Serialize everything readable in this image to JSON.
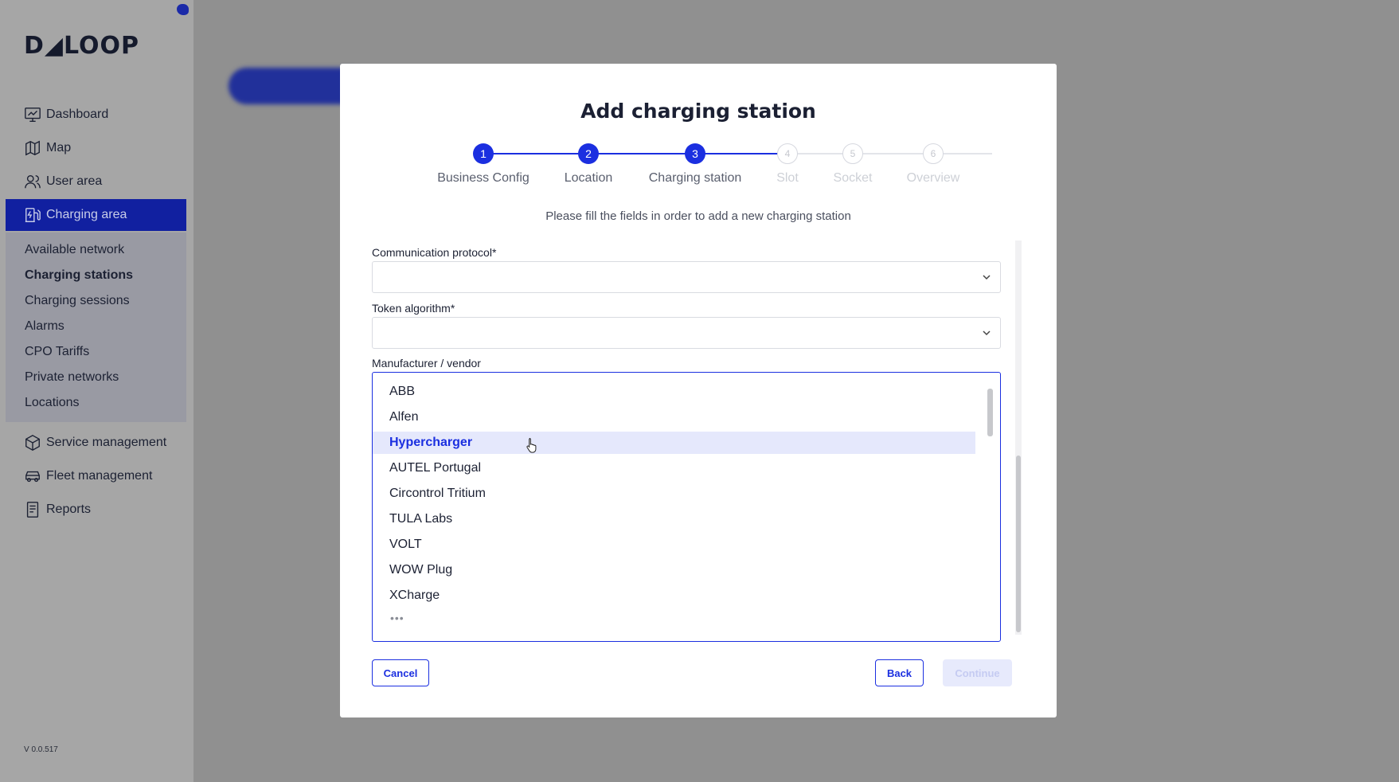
{
  "sidebar": {
    "logo": "D◢LOOP",
    "version": "V 0.0.517",
    "items": [
      {
        "label": "Dashboard",
        "icon": "dashboard-icon"
      },
      {
        "label": "Map",
        "icon": "map-icon"
      },
      {
        "label": "User area",
        "icon": "users-icon"
      },
      {
        "label": "Charging area",
        "icon": "charging-station-icon",
        "active": true
      },
      {
        "label": "Service management",
        "icon": "box-icon"
      },
      {
        "label": "Fleet management",
        "icon": "car-icon"
      },
      {
        "label": "Reports",
        "icon": "report-icon"
      }
    ],
    "submenu": [
      {
        "label": "Available network"
      },
      {
        "label": "Charging stations",
        "current": true
      },
      {
        "label": "Charging sessions"
      },
      {
        "label": "Alarms"
      },
      {
        "label": "CPO Tariffs"
      },
      {
        "label": "Private networks"
      },
      {
        "label": "Locations"
      }
    ]
  },
  "modal": {
    "title": "Add charging station",
    "subtitle": "Please fill the fields in order to add a new charging station",
    "steps": [
      {
        "number": "1",
        "label": "Business Config",
        "state": "done"
      },
      {
        "number": "2",
        "label": "Location",
        "state": "done"
      },
      {
        "number": "3",
        "label": "Charging station",
        "state": "done"
      },
      {
        "number": "4",
        "label": "Slot",
        "state": "todo"
      },
      {
        "number": "5",
        "label": "Socket",
        "state": "todo"
      },
      {
        "number": "6",
        "label": "Overview",
        "state": "todo"
      }
    ],
    "fields": {
      "communication_protocol": {
        "label": "Communication protocol*",
        "value": ""
      },
      "token_algorithm": {
        "label": "Token algorithm*",
        "value": ""
      },
      "manufacturer": {
        "label": "Manufacturer / vendor",
        "options": [
          "ABB",
          "Alfen",
          "Hypercharger",
          "AUTEL Portugal",
          "Circontrol Tritium",
          "TULA Labs",
          "VOLT",
          "WOW Plug",
          "XCharge"
        ],
        "hovered": "Hypercharger",
        "more": "•••"
      }
    },
    "buttons": {
      "cancel": "Cancel",
      "back": "Back",
      "continue": "Continue"
    }
  },
  "colors": {
    "accent": "#1b2fe0",
    "sidebar_active": "#1120a0",
    "hover_bg": "#e5e8fc"
  }
}
